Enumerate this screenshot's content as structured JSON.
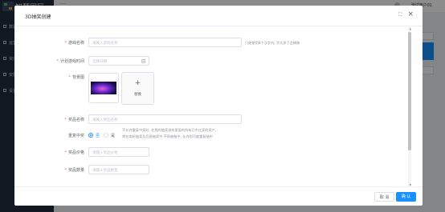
{
  "background_app": {
    "title": "智慧园区",
    "user_name": "测试用户01",
    "sidebar_items": [
      "数据",
      "运营",
      "资产",
      "安防",
      "设置"
    ]
  },
  "dialog": {
    "title": "3D抽奖创建",
    "fields": {
      "game_name": {
        "label": "游戏名称",
        "placeholder": "请输入游戏名称",
        "hint": "只能使用8个汉字内, 字太多了会横移"
      },
      "game_time": {
        "label": "计划游戏时间",
        "placeholder": "选择日期"
      },
      "background": {
        "label": "背景图",
        "upload_label": "替换"
      },
      "prize_name": {
        "label": "奖品名称",
        "placeholder": "请输入奖品名称"
      },
      "repeat_win": {
        "label": "重复中奖",
        "options": [
          "否",
          "是"
        ],
        "selected": "否",
        "hint_line1": "不允许重复中奖时, 在我的抽奖游戏里面的所有已中过奖的用户,",
        "hint_line2": "将在本轮抽奖及后面抽奖中 不再被抽中, 允许则可被重复抽中"
      },
      "prize_price": {
        "label": "奖品价格",
        "placeholder": "请输入奖品价格"
      },
      "prize_count": {
        "label": "奖品数量",
        "placeholder": "请输入奖品数量"
      }
    },
    "buttons": {
      "cancel": "取 消",
      "confirm": "确 认"
    }
  },
  "colors": {
    "primary": "#1890ff",
    "required": "#f56c6c",
    "overlay": "rgba(0,0,0,0.45)"
  }
}
